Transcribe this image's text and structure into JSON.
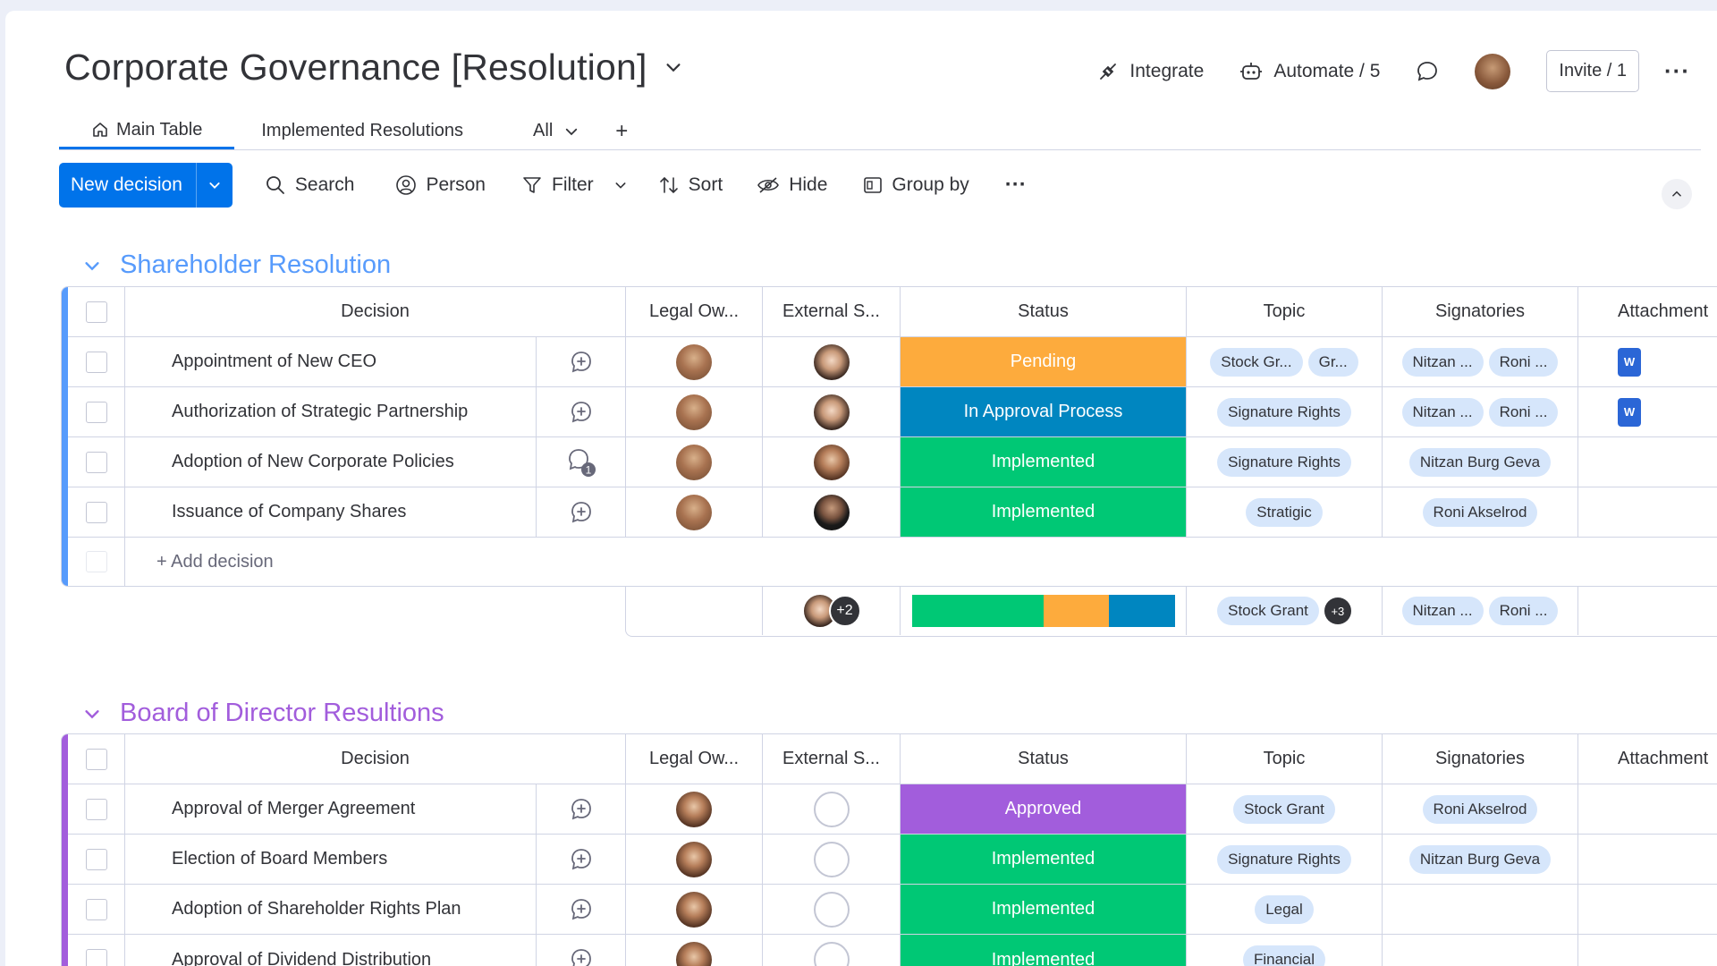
{
  "header": {
    "title": "Corporate Governance [Resolution]",
    "integrate": "Integrate",
    "automate": "Automate / 5",
    "invite": "Invite / 1"
  },
  "tabs": {
    "main": "Main Table",
    "implemented": "Implemented Resolutions",
    "all": "All",
    "add": "+"
  },
  "toolbar": {
    "new": "New decision",
    "search": "Search",
    "person": "Person",
    "filter": "Filter",
    "sort": "Sort",
    "hide": "Hide",
    "group_by": "Group by"
  },
  "columns": {
    "decision": "Decision",
    "legal": "Legal Ow...",
    "external": "External S...",
    "status": "Status",
    "topic": "Topic",
    "signatories": "Signatories",
    "attachment": "Attachment"
  },
  "colors": {
    "pending": "#fdab3d",
    "approval": "#0086c0",
    "implemented": "#00c875",
    "approved": "#a25ddc",
    "accent_blue": "#579bfc",
    "accent_purple": "#a25ddc"
  },
  "groups": [
    {
      "title": "Shareholder Resolution",
      "rows": [
        {
          "decision": "Appointment of New CEO",
          "status": "Pending",
          "topics": [
            "Stock Gr...",
            "Gr..."
          ],
          "sigs": [
            "Nitzan ...",
            "Roni ..."
          ],
          "attachment": "W"
        },
        {
          "decision": "Authorization of Strategic Partnership",
          "status": "In Approval Process",
          "topics": [
            "Signature Rights"
          ],
          "sigs": [
            "Nitzan ...",
            "Roni ..."
          ],
          "attachment": "W"
        },
        {
          "decision": "Adoption of New Corporate Policies",
          "status": "Implemented",
          "topics": [
            "Signature Rights"
          ],
          "sigs": [
            "Nitzan Burg Geva"
          ],
          "comment_count": "1"
        },
        {
          "decision": "Issuance of Company Shares",
          "status": "Implemented",
          "topics": [
            "Stratigic"
          ],
          "sigs": [
            "Roni Akselrod"
          ]
        }
      ],
      "add_label": "+ Add decision",
      "summary": {
        "ext_more": "+2",
        "topic": "Stock Grant",
        "topic_more": "+3",
        "sigs": [
          "Nitzan ...",
          "Roni ..."
        ],
        "status_distribution": {
          "Implemented": 2,
          "Pending": 1,
          "In Approval Process": 1
        }
      }
    },
    {
      "title": "Board of Director Resultions",
      "rows": [
        {
          "decision": "Approval of Merger Agreement",
          "status": "Approved",
          "topics": [
            "Stock Grant"
          ],
          "sigs": [
            "Roni Akselrod"
          ]
        },
        {
          "decision": "Election of Board Members",
          "status": "Implemented",
          "topics": [
            "Signature Rights"
          ],
          "sigs": [
            "Nitzan Burg Geva"
          ]
        },
        {
          "decision": "Adoption of Shareholder Rights Plan",
          "status": "Implemented",
          "topics": [
            "Legal"
          ],
          "sigs": []
        },
        {
          "decision": "Approval of Dividend Distribution",
          "status": "Implemented",
          "topics": [
            "Financial"
          ],
          "sigs": []
        }
      ]
    }
  ]
}
